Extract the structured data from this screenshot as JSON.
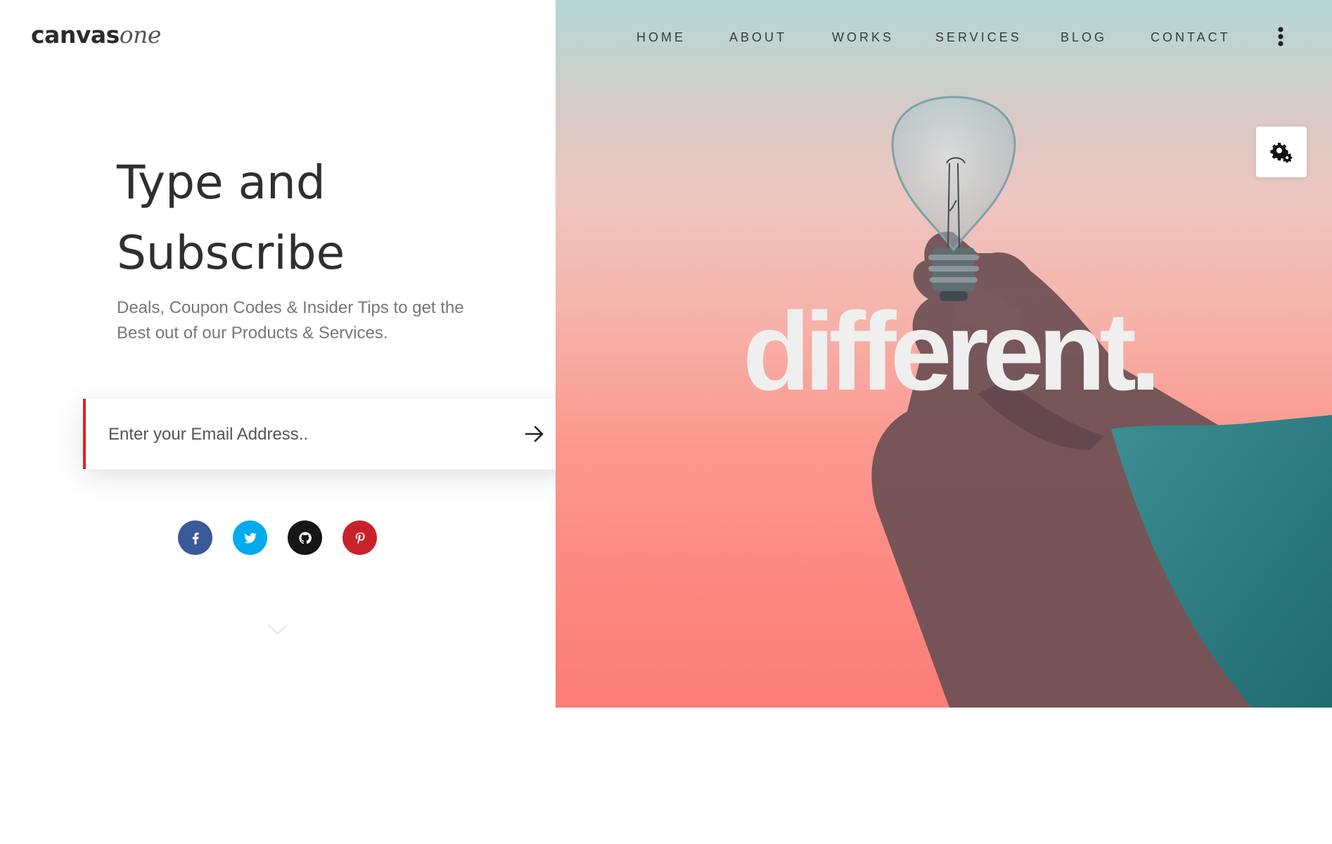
{
  "brand": {
    "logo_bold": "canvas",
    "logo_light": "one"
  },
  "nav": {
    "items": [
      {
        "label": "HOME"
      },
      {
        "label": "ABOUT"
      },
      {
        "label": "WORKS"
      },
      {
        "label": "SERVICES"
      },
      {
        "label": "BLOG"
      },
      {
        "label": "CONTACT"
      }
    ],
    "menu_icon": "vertical-dots-icon"
  },
  "hero": {
    "headline_line1": "Type and",
    "headline_line2": "Subscribe",
    "lede_line1": "Deals, Coupon Codes & Insider Tips to get the",
    "lede_line2": "Best out of our Products & Services.",
    "big_word": "different."
  },
  "subscribe": {
    "placeholder": "Enter your Email Address..",
    "value": "",
    "submit_icon": "arrow-right-icon",
    "accent_color": "#e02127"
  },
  "socials": [
    {
      "name": "facebook",
      "icon": "facebook-icon",
      "color": "#3b5998"
    },
    {
      "name": "twitter",
      "icon": "twitter-icon",
      "color": "#00acee"
    },
    {
      "name": "github",
      "icon": "github-icon",
      "color": "#171515"
    },
    {
      "name": "pinterest",
      "icon": "pinterest-icon",
      "color": "#c8232c"
    }
  ],
  "settings": {
    "icon": "gears-icon"
  },
  "scroll": {
    "icon": "chevron-down-icon"
  }
}
